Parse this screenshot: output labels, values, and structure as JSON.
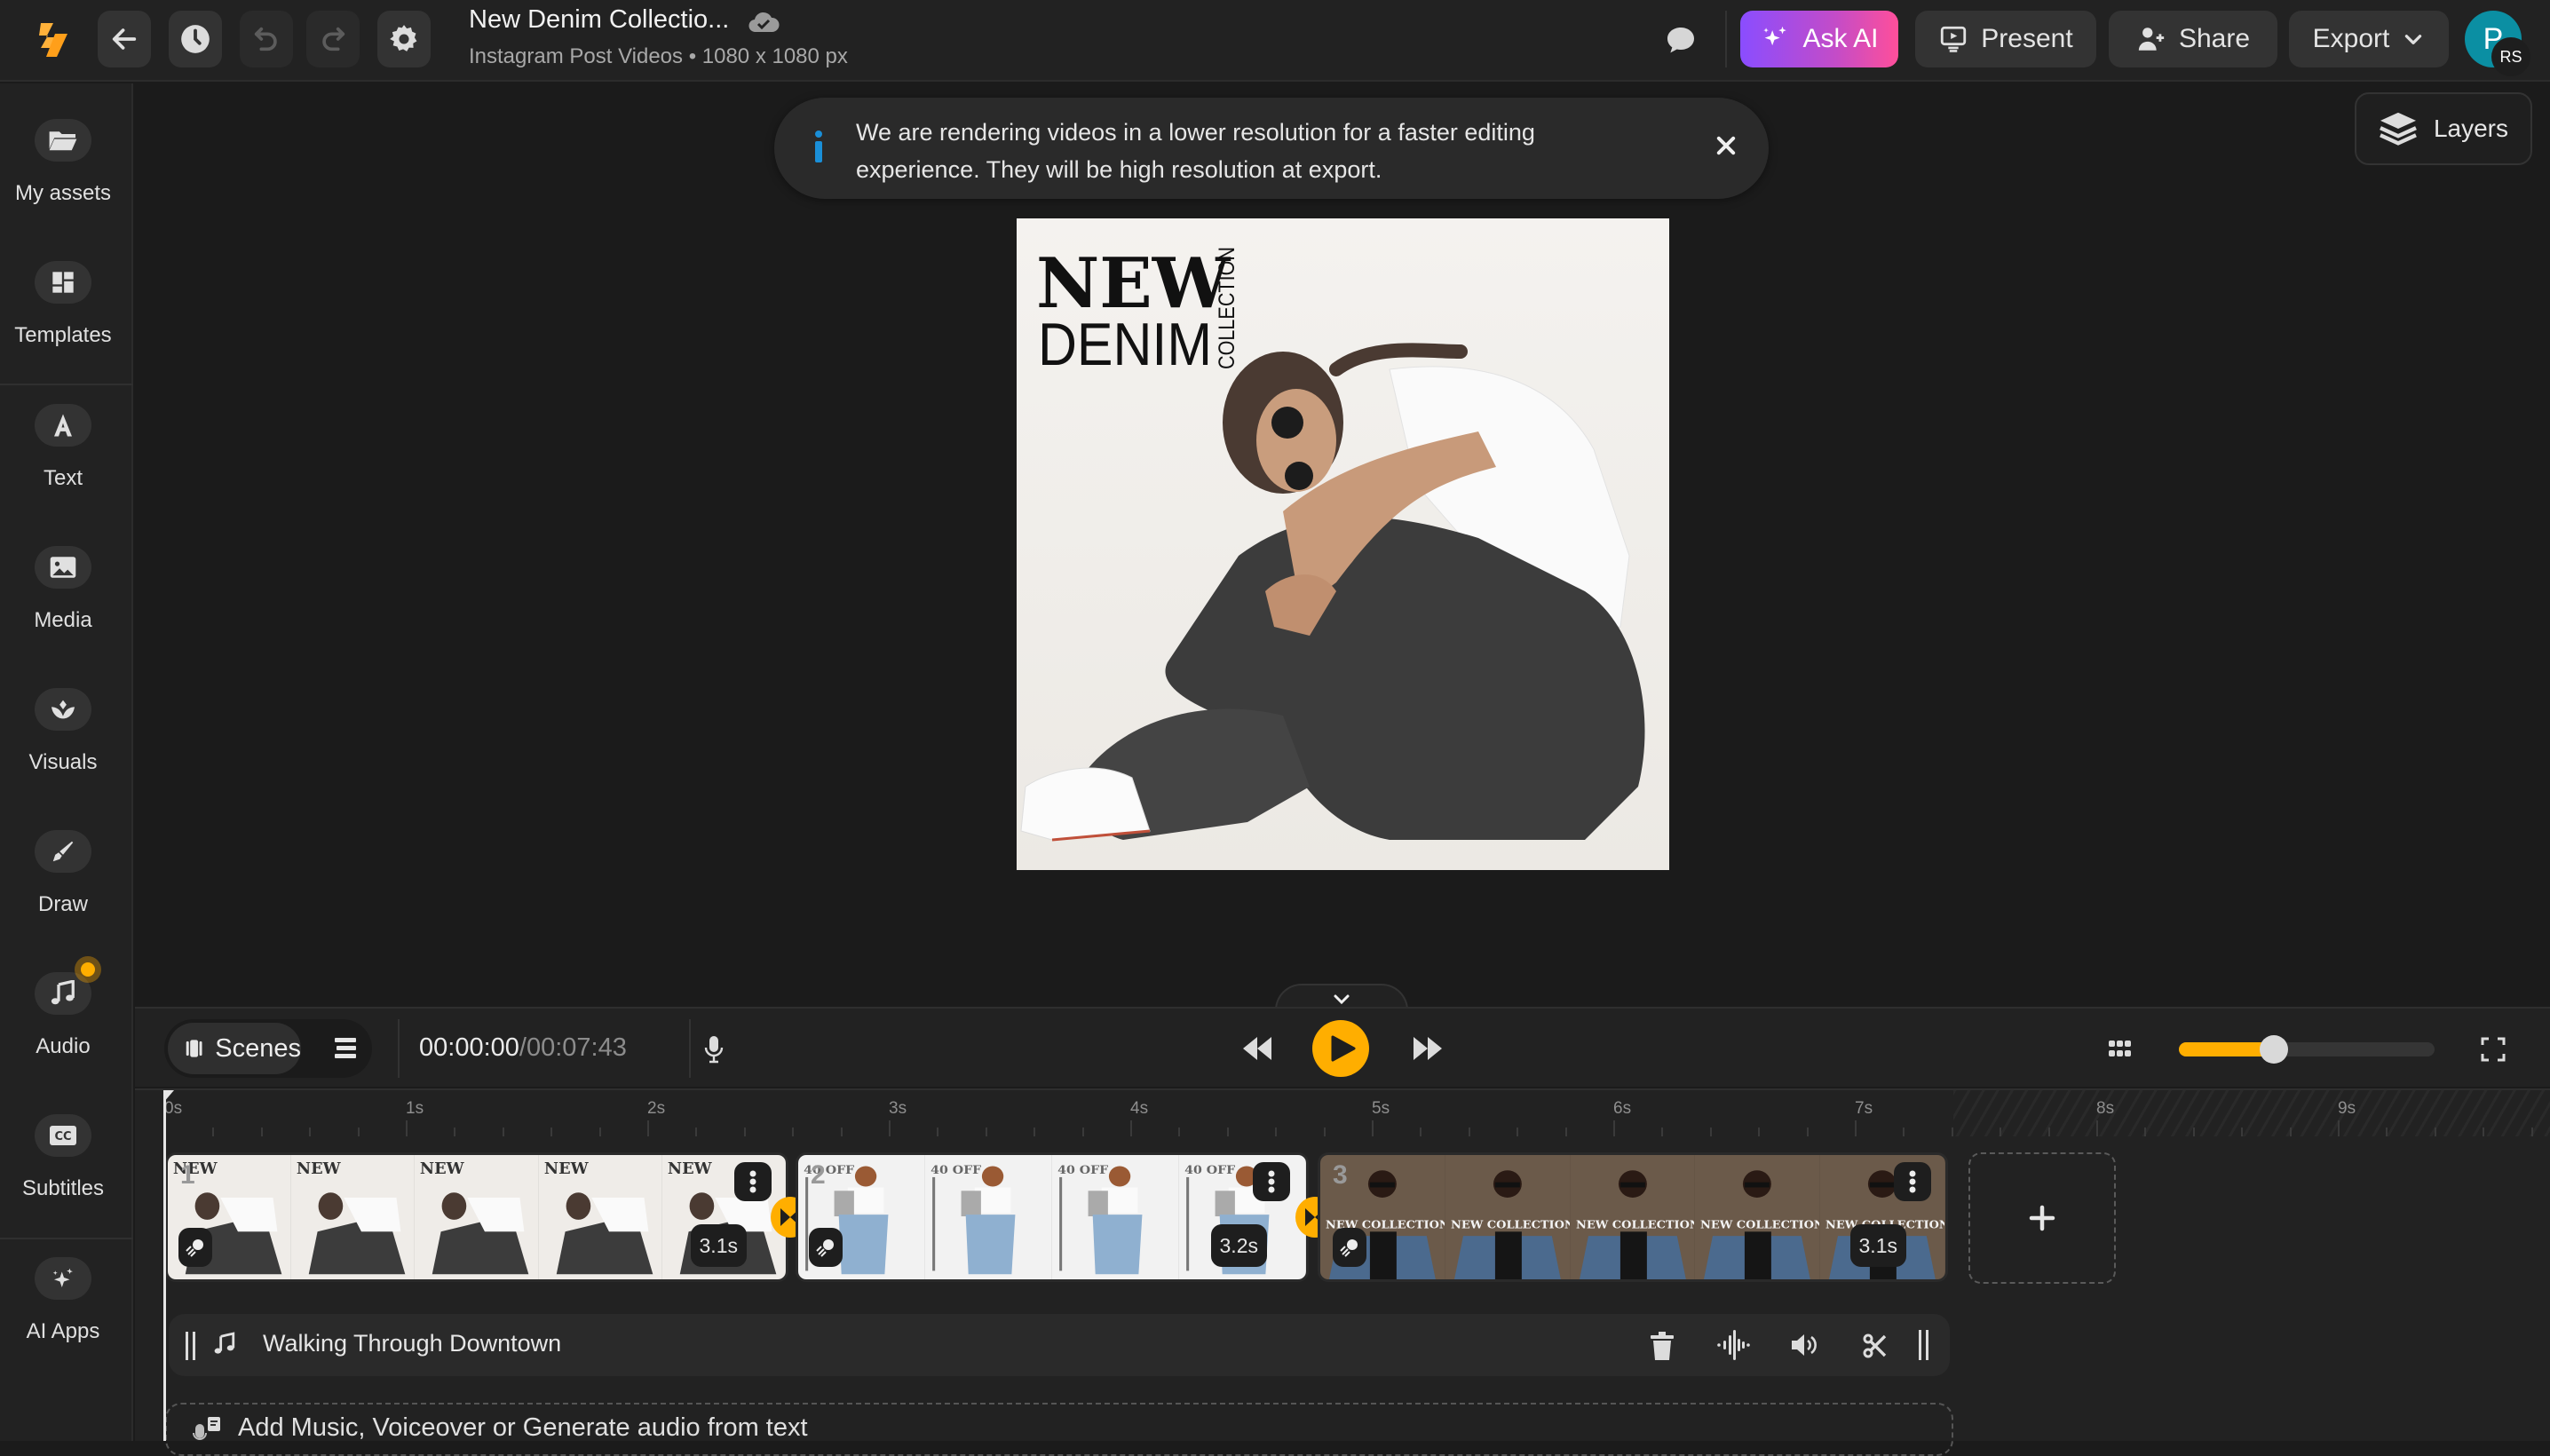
{
  "header": {
    "doc_title": "New Denim Collectio...",
    "doc_subtitle": "Instagram Post Videos • 1080 x 1080 px",
    "ask_ai_label": "Ask AI",
    "present_label": "Present",
    "share_label": "Share",
    "export_label": "Export",
    "avatar_initial": "P",
    "avatar_sub_initials": "RS"
  },
  "sidebar": {
    "items": [
      {
        "label": "My assets",
        "icon": "folder-icon"
      },
      {
        "label": "Templates",
        "icon": "templates-icon"
      },
      {
        "label": "Text",
        "icon": "text-icon"
      },
      {
        "label": "Media",
        "icon": "image-icon"
      },
      {
        "label": "Visuals",
        "icon": "visuals-icon"
      },
      {
        "label": "Draw",
        "icon": "pen-icon"
      },
      {
        "label": "Audio",
        "icon": "music-icon"
      },
      {
        "label": "Subtitles",
        "icon": "cc-icon"
      },
      {
        "label": "AI Apps",
        "icon": "sparkles-icon"
      }
    ]
  },
  "stage": {
    "toast_message": "We are rendering videos in a lower resolution for a faster editing experience. They will be high resolution at export.",
    "layers_label": "Layers",
    "artboard": {
      "headline_1": "NEW",
      "headline_2": "DENIM",
      "headline_vertical": "COLLECTION"
    }
  },
  "player": {
    "scenes_label": "Scenes",
    "current_time": "00:00:00",
    "total_time": "/00:07:43",
    "zoom_level_fraction": 0.37
  },
  "timeline": {
    "ruler_labels": [
      "0s",
      "1s",
      "2s",
      "3s",
      "4s",
      "5s",
      "6s",
      "7s",
      "8s",
      "9s"
    ],
    "scenes": [
      {
        "number": "1",
        "duration": "3.1s",
        "frame_text": "NEW DENIM"
      },
      {
        "number": "2",
        "duration": "3.2s",
        "frame_text": "40 OFF"
      },
      {
        "number": "3",
        "duration": "3.1s",
        "frame_text": "NEW COLLECTION"
      }
    ],
    "audio_track_name": "Walking Through Downtown",
    "add_audio_label": "Add Music, Voiceover or Generate audio from text"
  },
  "colors": {
    "accent": "#ffae00",
    "info": "#1a8fd8",
    "avatar": "#0b8fa3"
  }
}
